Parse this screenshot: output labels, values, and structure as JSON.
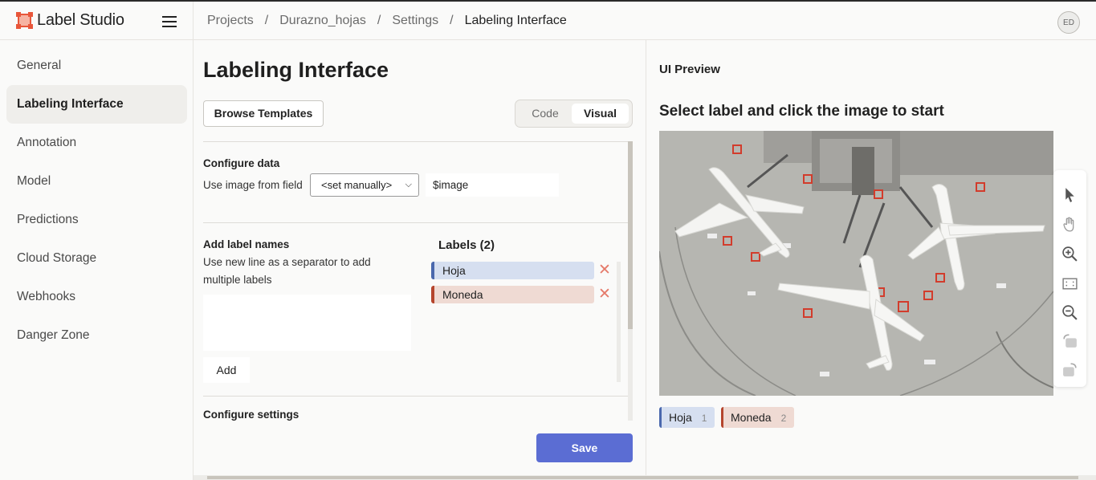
{
  "app": {
    "name": "Label Studio"
  },
  "breadcrumb": {
    "items": [
      "Projects",
      "Durazno_hojas",
      "Settings",
      "Labeling Interface"
    ]
  },
  "user": {
    "initials": "ED"
  },
  "sidebar": {
    "items": [
      {
        "label": "General"
      },
      {
        "label": "Labeling Interface"
      },
      {
        "label": "Annotation"
      },
      {
        "label": "Model"
      },
      {
        "label": "Predictions"
      },
      {
        "label": "Cloud Storage"
      },
      {
        "label": "Webhooks"
      },
      {
        "label": "Danger Zone"
      }
    ],
    "active": "Labeling Interface"
  },
  "main": {
    "title": "Labeling Interface",
    "browse_templates": "Browse Templates",
    "toggle": {
      "code": "Code",
      "visual": "Visual",
      "selected": "Visual"
    },
    "configure_data": {
      "title": "Configure data",
      "field_label": "Use image from field",
      "select_value": "<set manually>",
      "field_value": "$image"
    },
    "add_labels": {
      "title": "Add label names",
      "hint_line1": "Use new line as a separator to add",
      "hint_line2": "multiple labels",
      "textarea_value": "",
      "add_button": "Add"
    },
    "labels": {
      "heading": "Labels (2)",
      "items": [
        {
          "name": "Hoja",
          "color": "#4a68ad"
        },
        {
          "name": "Moneda",
          "color": "#b5452d"
        }
      ],
      "remove_symbol": "✕"
    },
    "configure_settings": {
      "title": "Configure settings"
    },
    "save_button": "Save"
  },
  "preview": {
    "section_label": "UI Preview",
    "header": "Select label and click the image to start",
    "image_description": "aerial-view-airport-airplanes",
    "tools": [
      "pointer-icon",
      "hand-pan-icon",
      "zoom-in-icon",
      "fit-screen-icon",
      "zoom-out-icon",
      "rotate-left-icon",
      "rotate-right-icon"
    ],
    "label_chips": [
      {
        "name": "Hoja",
        "hotkey": "1"
      },
      {
        "name": "Moneda",
        "hotkey": "2"
      }
    ]
  },
  "colors": {
    "accent": "#5b6dd3",
    "brand": "#e8563a",
    "label_blue": "#4a68ad",
    "label_red": "#b5452d"
  }
}
